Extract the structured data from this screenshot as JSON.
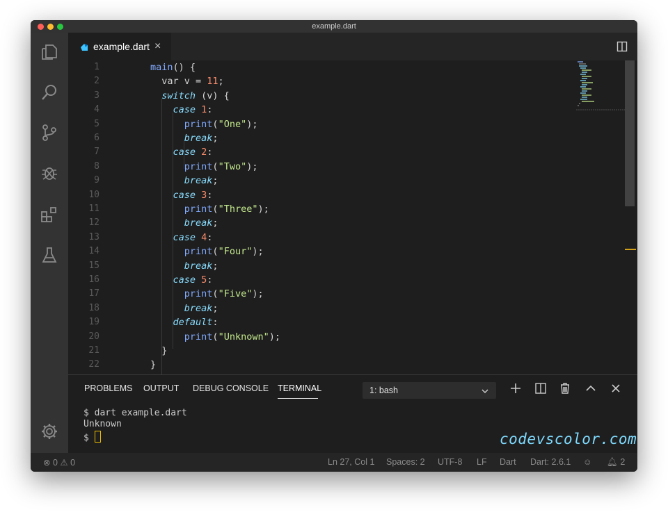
{
  "window": {
    "title": "example.dart"
  },
  "tab": {
    "filename": "example.dart",
    "close_glyph": "×"
  },
  "editor": {
    "line_numbers": [
      "1",
      "2",
      "3",
      "4",
      "5",
      "6",
      "7",
      "8",
      "9",
      "10",
      "11",
      "12",
      "13",
      "14",
      "15",
      "16",
      "17",
      "18",
      "19",
      "20",
      "21",
      "22"
    ]
  },
  "panel": {
    "tabs": [
      "PROBLEMS",
      "OUTPUT",
      "DEBUG CONSOLE",
      "TERMINAL"
    ],
    "active_tab": "TERMINAL",
    "shell_select": "1: bash"
  },
  "terminal": {
    "lines": [
      "$ dart example.dart",
      "Unknown",
      "$ "
    ]
  },
  "watermark": "codevscolor.com",
  "statusbar": {
    "errors": "0",
    "warnings": "0",
    "position": "Ln 27, Col 1",
    "spaces": "Spaces: 2",
    "encoding": "UTF-8",
    "eol": "LF",
    "language": "Dart",
    "sdk": "Dart: 2.6.1",
    "notifications": "2"
  },
  "colors": {
    "background": "#1e1e1e",
    "activity_bar": "#333333",
    "keyword": "#89ddff",
    "function": "#82aaff",
    "number": "#f78c6c",
    "string": "#c3e88d",
    "cursor": "#f0c000",
    "watermark": "#7fdbff"
  }
}
